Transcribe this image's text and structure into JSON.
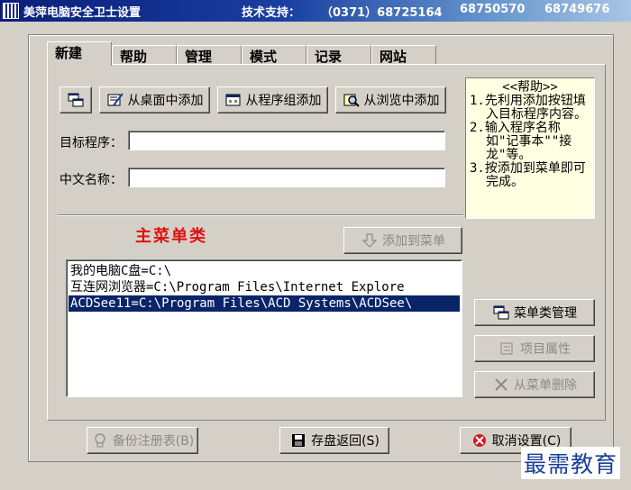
{
  "window": {
    "title": "美萍电脑安全卫士设置",
    "support_label": "技术支持：",
    "phones": [
      "（0371）68725164",
      "68750570",
      "68749676"
    ]
  },
  "tabs": [
    "新建",
    "帮助",
    "管理",
    "模式",
    "记录",
    "网站"
  ],
  "active_tab": "新建",
  "toolbar": {
    "add_desktop": "从桌面中添加",
    "add_program_group": "从程序组添加",
    "add_browse": "从浏览中添加"
  },
  "form": {
    "target_label": "目标程序：",
    "target_value": "",
    "name_label": "中文名称：",
    "name_value": ""
  },
  "help": {
    "title": "<<帮助>>",
    "lines": [
      "1.先利用添加按钮填入目标程序内容。",
      "2.输入程序名称如\"记事本\"\"接龙\"等。",
      "3.按添加到菜单即可完成。"
    ]
  },
  "menu": {
    "heading": "主菜单类",
    "add_to_menu": "添加到菜单",
    "items": [
      "我的电脑C盘=C:\\",
      "互连网浏览器=C:\\Program Files\\Internet Explore",
      "ACDSee11=C:\\Program Files\\ACD Systems\\ACDSee\\"
    ],
    "selected_index": 2
  },
  "side_buttons": {
    "category_manage": "菜单类管理",
    "item_properties": "项目属性",
    "delete_from_menu": "从菜单删除"
  },
  "bottom_buttons": {
    "backup_registry": "备份注册表(B)",
    "save_return": "存盘返回(S)",
    "cancel_settings": "取消设置(C)"
  },
  "watermark": "最需教育",
  "colors": {
    "window_bg": "#d4d0c8",
    "title_gradient_start": "#0a1e7a",
    "selection": "#0a246a",
    "heading_red": "#e01010",
    "help_bg": "#ffffe1"
  }
}
